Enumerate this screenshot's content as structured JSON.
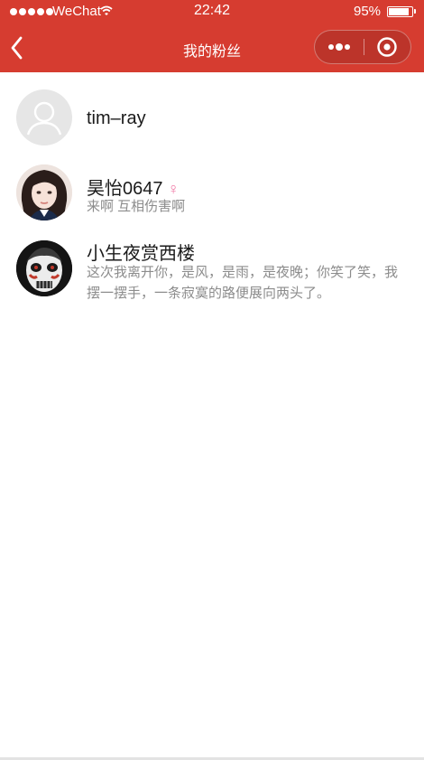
{
  "status_bar": {
    "carrier": "WeChat",
    "time": "22:42",
    "battery_percent": "95%",
    "battery_level": 0.95
  },
  "nav": {
    "title": "我的粉丝",
    "back_icon": "chevron-left-icon",
    "more_icon": "more-dots-icon",
    "close_icon": "target-close-icon"
  },
  "colors": {
    "header_bg": "#d63c30",
    "female_symbol": "#f07aa6",
    "secondary_text": "#8c8c8c"
  },
  "fans": [
    {
      "name": "tim–ray",
      "gender": "",
      "desc": ""
    },
    {
      "name": "昊怡0647",
      "gender": "♀",
      "desc": "来啊 互相伤害啊"
    },
    {
      "name": "小生夜赏西楼",
      "gender": "",
      "desc": "这次我离开你，是风，是雨，是夜晚；你笑了笑，我摆一摆手，一条寂寞的路便展向两头了。"
    }
  ]
}
